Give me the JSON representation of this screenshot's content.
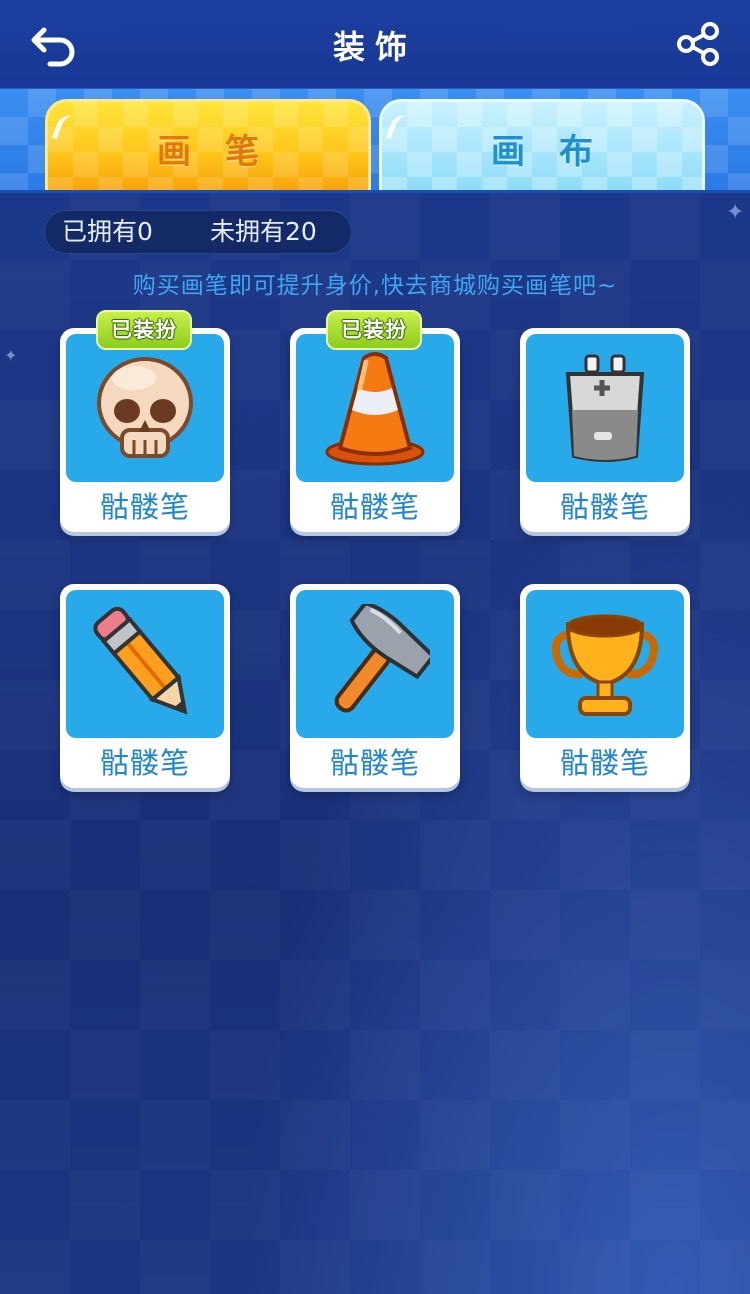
{
  "header": {
    "title": "装饰",
    "back_icon": "back-arrow-icon",
    "share_icon": "share-icon"
  },
  "tabs": [
    {
      "label": "画笔",
      "active": true,
      "color": "#ffc41a"
    },
    {
      "label": "画布",
      "active": false,
      "color": "#8edcf8"
    }
  ],
  "stats": {
    "owned": "已拥有0",
    "not_owned": "未拥有20"
  },
  "tip": "购买画笔即可提升身价,快去商城购买画笔吧~",
  "items": [
    {
      "name": "骷髅笔",
      "icon": "skull-icon",
      "badge": "已装扮"
    },
    {
      "name": "骷髅笔",
      "icon": "traffic-cone-icon",
      "badge": "已装扮"
    },
    {
      "name": "骷髅笔",
      "icon": "battery-icon",
      "badge": ""
    },
    {
      "name": "骷髅笔",
      "icon": "pencil-icon",
      "badge": ""
    },
    {
      "name": "骷髅笔",
      "icon": "hammer-icon",
      "badge": ""
    },
    {
      "name": "骷髅笔",
      "icon": "trophy-icon",
      "badge": ""
    }
  ],
  "colors": {
    "background": "#1d3684",
    "card_inner": "#27a9ea",
    "item_name": "#1f86cf",
    "tip_text": "#3ea6f0",
    "badge": "#8ccd1c"
  }
}
